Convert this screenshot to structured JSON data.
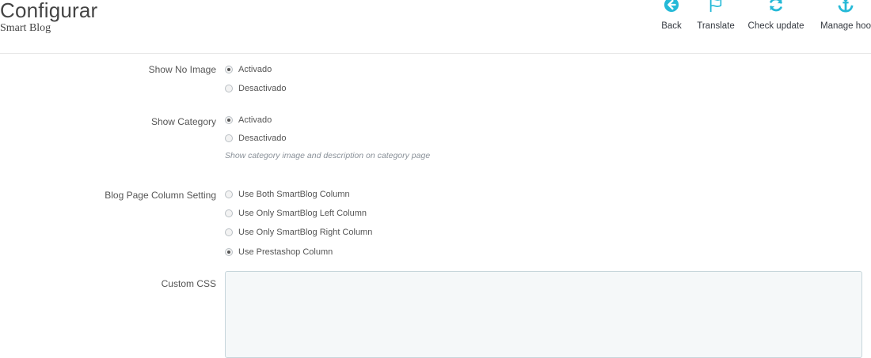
{
  "header": {
    "title": "Configurar",
    "subtitle": "Smart Blog",
    "toolbar": [
      {
        "label": "Back",
        "icon": "back-arrow-circle-icon"
      },
      {
        "label": "Translate",
        "icon": "flag-icon"
      },
      {
        "label": "Check update",
        "icon": "refresh-icon"
      },
      {
        "label": "Manage hoo",
        "icon": "anchor-icon"
      }
    ]
  },
  "form": {
    "show_no_image": {
      "label": "Show No Image",
      "options": [
        {
          "label": "Activado",
          "checked": true
        },
        {
          "label": "Desactivado",
          "checked": false
        }
      ]
    },
    "show_category": {
      "label": "Show Category",
      "options": [
        {
          "label": "Activado",
          "checked": true
        },
        {
          "label": "Desactivado",
          "checked": false
        }
      ],
      "help": "Show category image and description on category page"
    },
    "column_setting": {
      "label": "Blog Page Column Setting",
      "options": [
        {
          "label": "Use Both SmartBlog Column",
          "checked": false
        },
        {
          "label": "Use Only SmartBlog Left Column",
          "checked": false
        },
        {
          "label": "Use Only SmartBlog Right Column",
          "checked": false
        },
        {
          "label": "Use Prestashop Column",
          "checked": true
        }
      ]
    },
    "custom_css": {
      "label": "Custom CSS",
      "value": ""
    }
  },
  "colors": {
    "toolbar_icon": "#25b9d7",
    "textarea_bg": "#f5f8f9",
    "textarea_border": "#c7d6db",
    "text": "#555555"
  }
}
